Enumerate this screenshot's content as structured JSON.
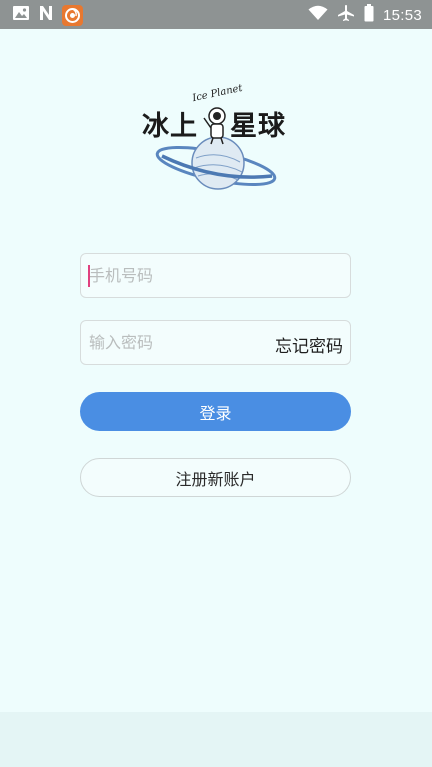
{
  "status_bar": {
    "time": "15:53",
    "left_icons": [
      "gallery-icon",
      "n-app-icon",
      "orange-app-icon"
    ],
    "right_icons": [
      "wifi-icon",
      "airplane-mode-icon",
      "battery-icon"
    ]
  },
  "logo": {
    "title_left": "冰上",
    "title_right": "星球",
    "subtitle": "Ice Planet"
  },
  "form": {
    "phone_placeholder": "手机号码",
    "password_placeholder": "输入密码",
    "forgot_label": "忘记密码",
    "login_label": "登录",
    "register_label": "注册新账户"
  },
  "colors": {
    "background": "#eefdfd",
    "primary": "#4a8ee3",
    "status_bar": "#8e9393",
    "caret": "#e0407f"
  }
}
